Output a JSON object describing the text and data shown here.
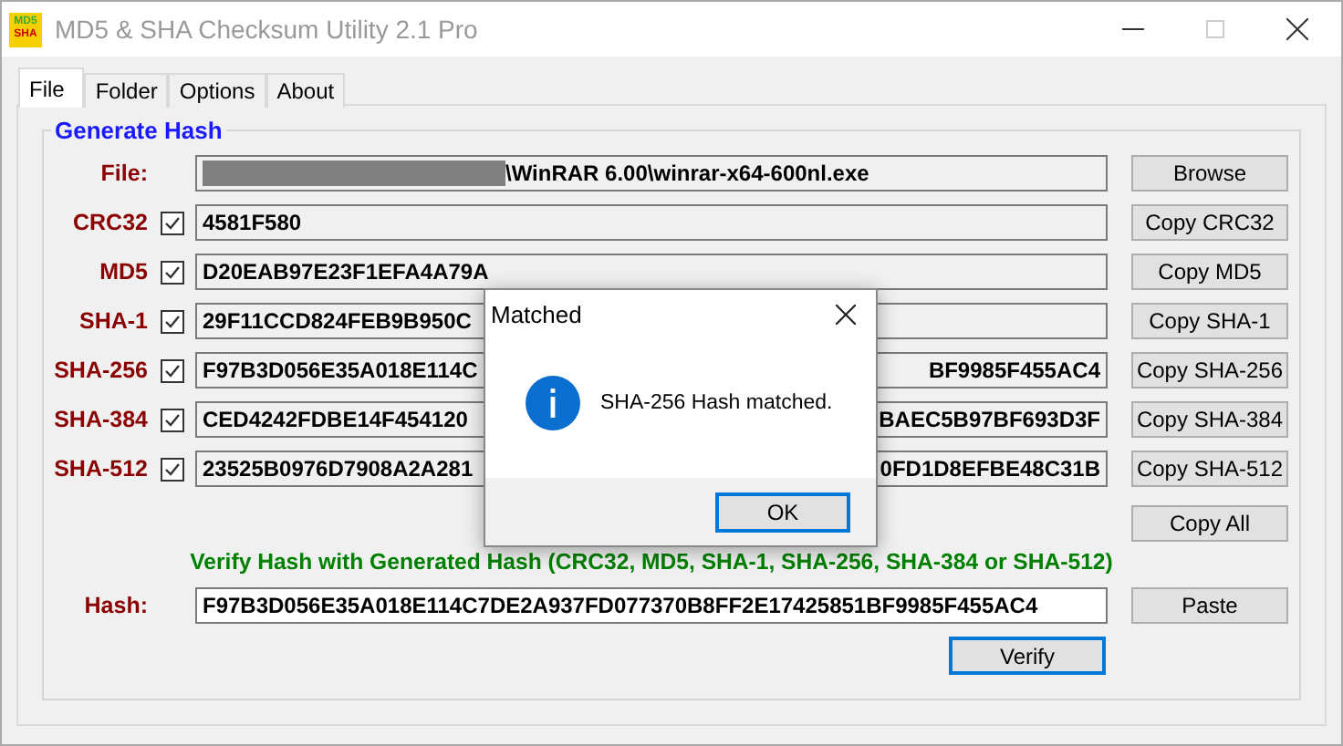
{
  "window": {
    "title": "MD5 & SHA Checksum Utility 2.1 Pro",
    "logo_lines": [
      "MD5",
      "SHA"
    ],
    "maximize_disabled": true
  },
  "tabs": [
    {
      "label": "File",
      "selected": true
    },
    {
      "label": "Folder",
      "selected": false
    },
    {
      "label": "Options",
      "selected": false
    },
    {
      "label": "About",
      "selected": false
    }
  ],
  "generate": {
    "title": "Generate Hash",
    "file_label": "File:",
    "file_redacted": true,
    "file_path": "\\WinRAR 6.00\\winrar-x64-600nl.exe",
    "browse_button": "Browse",
    "rows": [
      {
        "label": "CRC32",
        "checked": true,
        "value_start": "4581F580",
        "value_end": "",
        "button": "Copy CRC32"
      },
      {
        "label": "MD5",
        "checked": true,
        "value_start": "D20EAB97E23F1EFA4A79A",
        "value_end": "",
        "button": "Copy MD5"
      },
      {
        "label": "SHA-1",
        "checked": true,
        "value_start": "29F11CCD824FEB9B950C",
        "value_end": "",
        "button": "Copy SHA-1"
      },
      {
        "label": "SHA-256",
        "checked": true,
        "value_start": "F97B3D056E35A018E114C",
        "value_end": "BF9985F455AC4",
        "button": "Copy SHA-256"
      },
      {
        "label": "SHA-384",
        "checked": true,
        "value_start": "CED4242FDBE14F454120",
        "value_end": "BAEC5B97BF693D3F",
        "button": "Copy SHA-384"
      },
      {
        "label": "SHA-512",
        "checked": true,
        "value_start": "23525B0976D7908A2A281",
        "value_end": "0FD1D8EFBE48C31B",
        "button": "Copy SHA-512"
      }
    ],
    "copy_all_button": "Copy All"
  },
  "verify": {
    "title": "Verify Hash with Generated Hash (CRC32, MD5, SHA-1, SHA-256, SHA-384 or SHA-512)",
    "hash_label": "Hash:",
    "hash_value": "F97B3D056E35A018E114C7DE2A937FD077370B8FF2E17425851BF9985F455AC4",
    "paste_button": "Paste",
    "verify_button": "Verify"
  },
  "dialog": {
    "title": "Matched",
    "message": "SHA-256 Hash matched.",
    "ok_button": "OK"
  }
}
